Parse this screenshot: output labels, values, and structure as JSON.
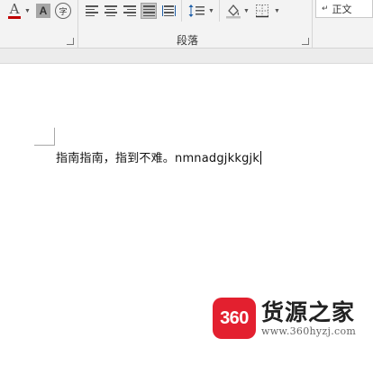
{
  "ribbon": {
    "font_color_glyph": "A",
    "char_shading_glyph": "A",
    "enclose_char_glyph": "字",
    "paragraph_group_label": "段落",
    "style_gallery": {
      "mark": "↵",
      "label": "正文"
    },
    "icons": [
      "font-color-icon",
      "character-shading-icon",
      "enclose-characters-icon",
      "align-left-icon",
      "align-center-icon",
      "align-right-icon",
      "justify-icon",
      "distributed-icon",
      "line-spacing-icon",
      "shading-icon",
      "borders-icon",
      "dialog-launcher-icon"
    ],
    "colors": {
      "font_color_bar": "#c00000",
      "ribbon_bg": "#f3f3f3"
    }
  },
  "document": {
    "body_text": "指南指南，指到不难。nmnadgjkkgjk"
  },
  "watermark": {
    "logo_text": "360",
    "brand": "货源之家",
    "url": "www.360hyzj.com",
    "logo_color": "#e3202f"
  }
}
